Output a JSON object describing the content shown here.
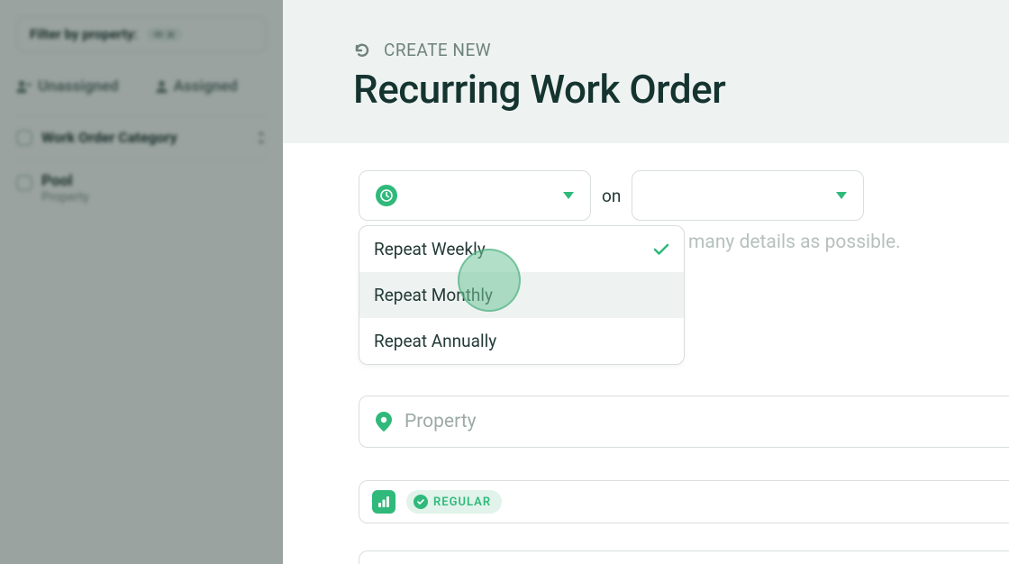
{
  "sidebar": {
    "filter_label": "Filter by property:",
    "unassigned_label": "Unassigned",
    "assigned_label": "Assigned",
    "category_header": "Work Order Category",
    "pool_title": "Pool",
    "pool_subtitle": "Property"
  },
  "header": {
    "create_label": "CREATE NEW",
    "title": "Recurring Work Order"
  },
  "main": {
    "on_label": "on",
    "details_hint": "many details as possible.",
    "property_placeholder": "Property",
    "priority_label": "REGULAR"
  },
  "dropdown": {
    "items": [
      {
        "label": "Repeat Weekly",
        "selected": true,
        "highlight": false
      },
      {
        "label": "Repeat Monthly",
        "selected": false,
        "highlight": true
      },
      {
        "label": "Repeat Annually",
        "selected": false,
        "highlight": false
      }
    ]
  },
  "colors": {
    "accent": "#2fb97a",
    "dark": "#153430"
  }
}
